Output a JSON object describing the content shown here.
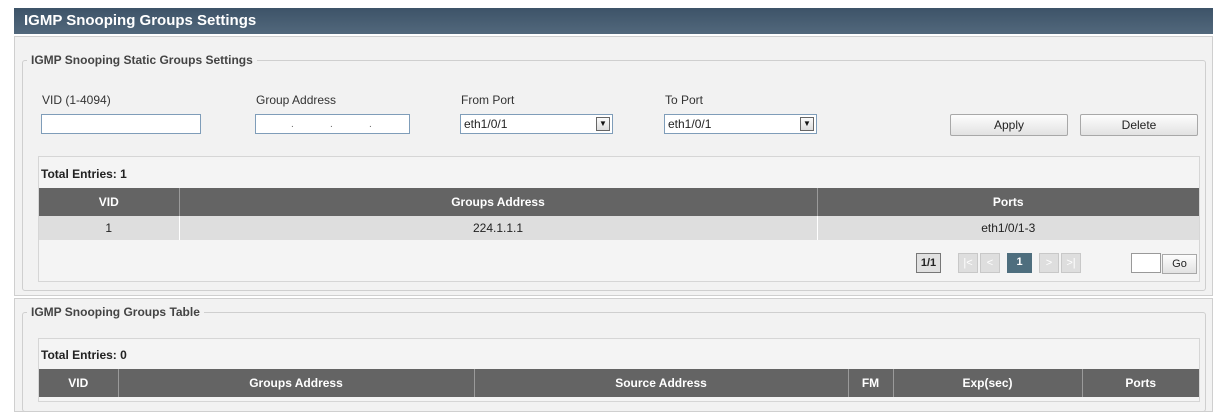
{
  "header": {
    "title": "IGMP Snooping Groups Settings"
  },
  "static_groups": {
    "legend": "IGMP Snooping Static Groups Settings",
    "form": {
      "vid_label": "VID (1-4094)",
      "vid_value": "",
      "group_address_label": "Group Address",
      "group_address_value": "",
      "from_port_label": "From Port",
      "from_port_value": "eth1/0/1",
      "to_port_label": "To Port",
      "to_port_value": "eth1/0/1",
      "apply_label": "Apply",
      "delete_label": "Delete"
    },
    "table": {
      "total_entries": "Total Entries: 1",
      "columns": [
        "VID",
        "Groups Address",
        "Ports"
      ],
      "rows": [
        [
          "1",
          "224.1.1.1",
          "eth1/0/1-3"
        ]
      ]
    },
    "pagination": {
      "page_count": "1/1",
      "first": "|<",
      "prev": "<",
      "current": "1",
      "next": ">",
      "last": ">|",
      "go_input": "",
      "go_label": "Go"
    }
  },
  "groups_table": {
    "legend": "IGMP Snooping Groups Table",
    "total_entries": "Total Entries: 0",
    "columns": [
      "VID",
      "Groups Address",
      "Source Address",
      "FM",
      "Exp(sec)",
      "Ports"
    ]
  }
}
